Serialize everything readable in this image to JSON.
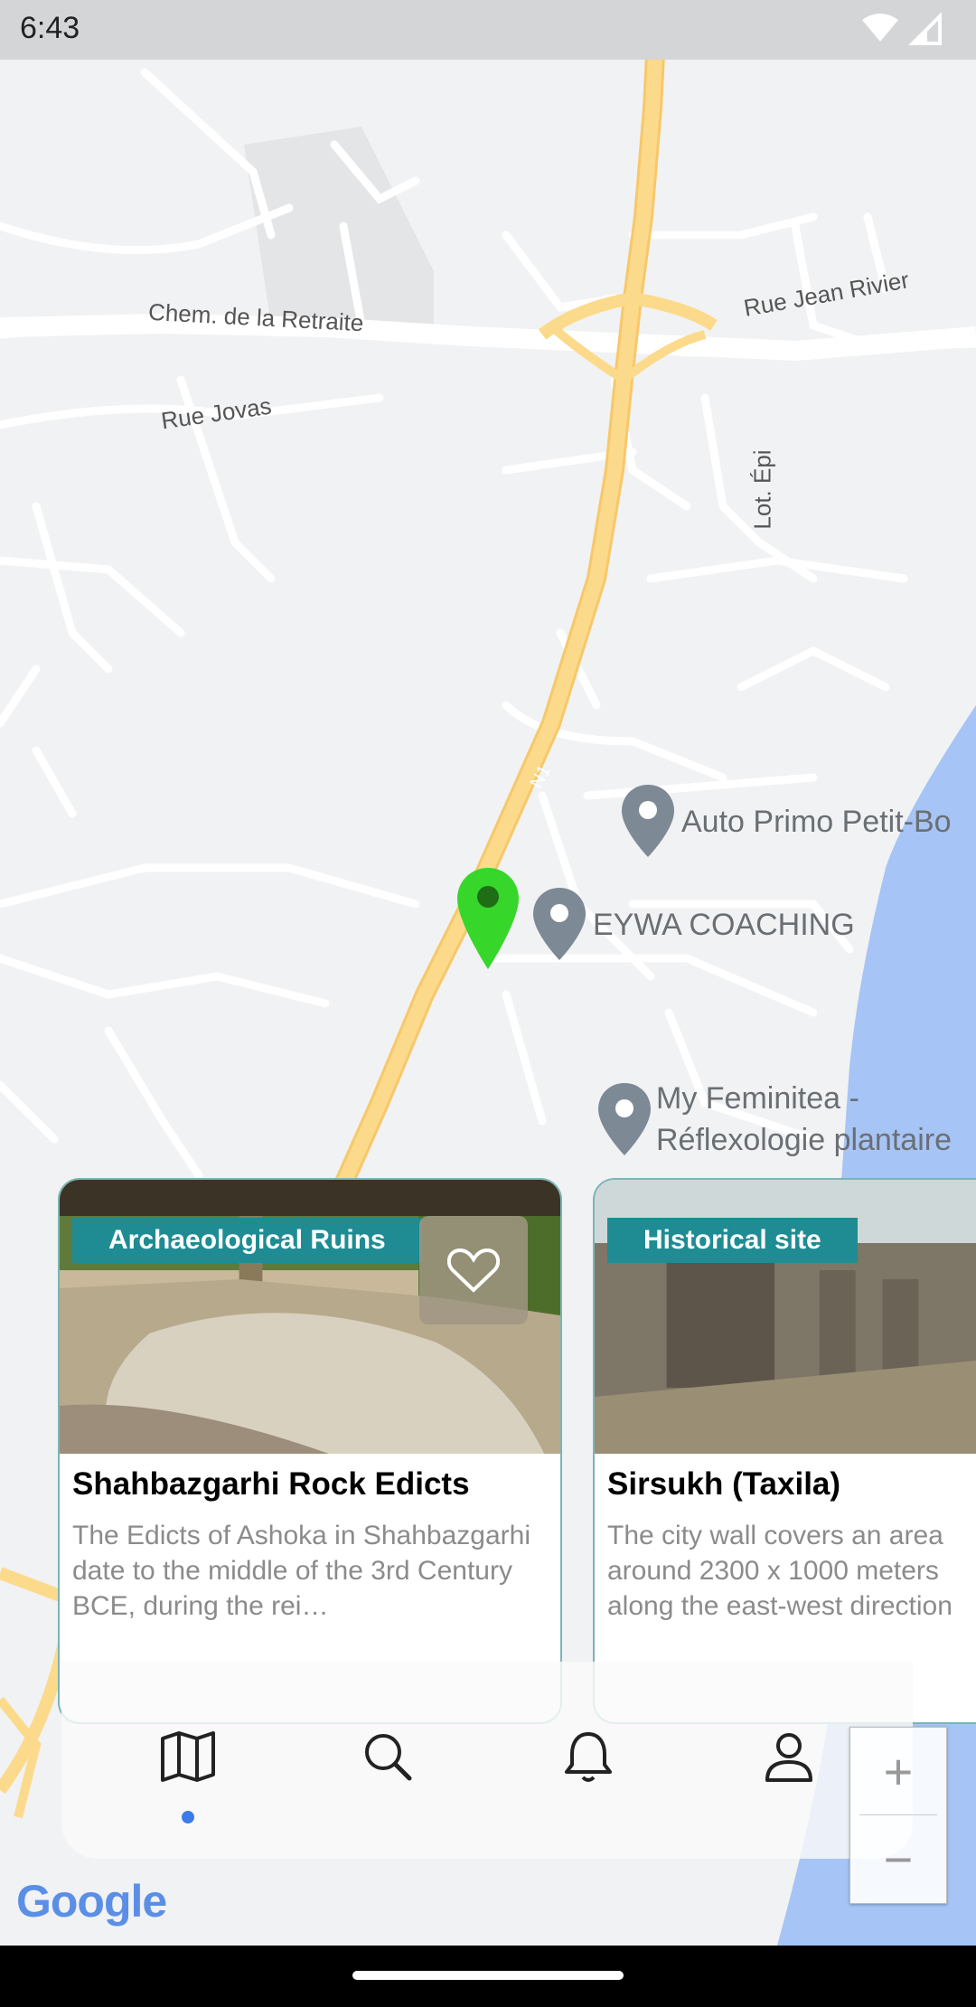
{
  "status_bar": {
    "time": "6:43"
  },
  "map": {
    "street_labels": [
      "Chem. de la Retraite",
      "Rue Jovas",
      "Rue Jean Rivier",
      "Lot. Épi",
      "N1"
    ],
    "pois": [
      "Auto Primo Petit-Bo",
      "EYWA COACHING",
      "My Feminitea -",
      "Réflexologie plantaire"
    ],
    "attribution": "Google",
    "zoom_in": "+",
    "zoom_out": "−"
  },
  "cards": [
    {
      "category": "Archaeological Ruins",
      "title": "Shahbazgarhi Rock Edicts",
      "description": "The Edicts of Ashoka in Shahbazgarhi date to the middle of the 3rd Century BCE, during the rei…"
    },
    {
      "category": "Historical site",
      "title": "Sirsukh (Taxila)",
      "description": "The city wall covers an area around 2300 x 1000 meters along the east-west direction"
    }
  ],
  "bottom_nav": {
    "items": [
      {
        "icon": "map-icon",
        "active": true
      },
      {
        "icon": "search-icon",
        "active": false
      },
      {
        "icon": "bell-icon",
        "active": false
      },
      {
        "icon": "user-icon",
        "active": false
      }
    ]
  },
  "colors": {
    "chip": "#1f8c93",
    "marker": "#37d62b",
    "road": "#fbd67f",
    "water": "#a6c4f5",
    "active_dot": "#3d7be8"
  }
}
